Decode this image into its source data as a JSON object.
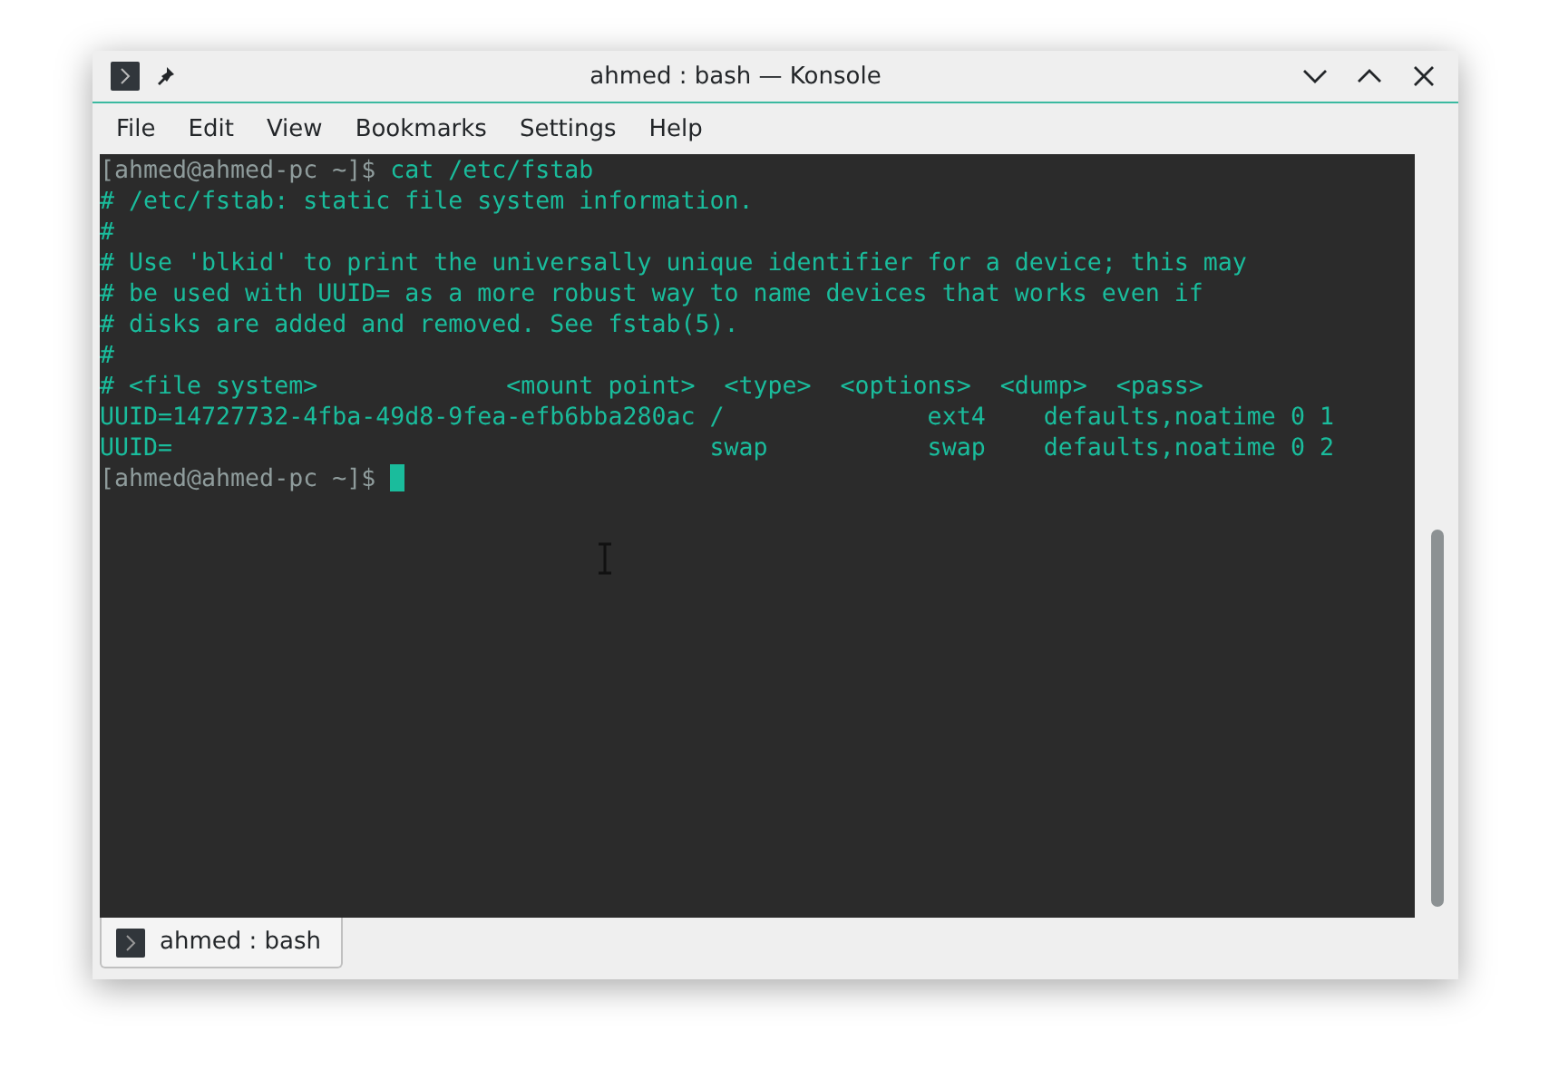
{
  "window": {
    "title": "ahmed : bash — Konsole"
  },
  "menu": [
    "File",
    "Edit",
    "View",
    "Bookmarks",
    "Settings",
    "Help"
  ],
  "terminal": {
    "lines": [
      {
        "kind": "prompt",
        "prompt": "[ahmed@ahmed-pc ~]$",
        "command": "cat /etc/fstab"
      },
      {
        "kind": "output",
        "text": "# /etc/fstab: static file system information."
      },
      {
        "kind": "output",
        "text": "#"
      },
      {
        "kind": "output",
        "text": "# Use 'blkid' to print the universally unique identifier for a device; this may"
      },
      {
        "kind": "output",
        "text": "# be used with UUID= as a more robust way to name devices that works even if"
      },
      {
        "kind": "output",
        "text": "# disks are added and removed. See fstab(5)."
      },
      {
        "kind": "output",
        "text": "#"
      },
      {
        "kind": "output",
        "text": "# <file system>             <mount point>  <type>  <options>  <dump>  <pass>"
      },
      {
        "kind": "output",
        "text": "UUID=14727732-4fba-49d8-9fea-efb6bba280ac /              ext4    defaults,noatime 0 1"
      },
      {
        "kind": "output",
        "text": "UUID=                                     swap           swap    defaults,noatime 0 2"
      },
      {
        "kind": "prompt",
        "prompt": "[ahmed@ahmed-pc ~]$"
      }
    ]
  },
  "tabs": [
    {
      "label": "ahmed : bash",
      "selected": true
    }
  ]
}
